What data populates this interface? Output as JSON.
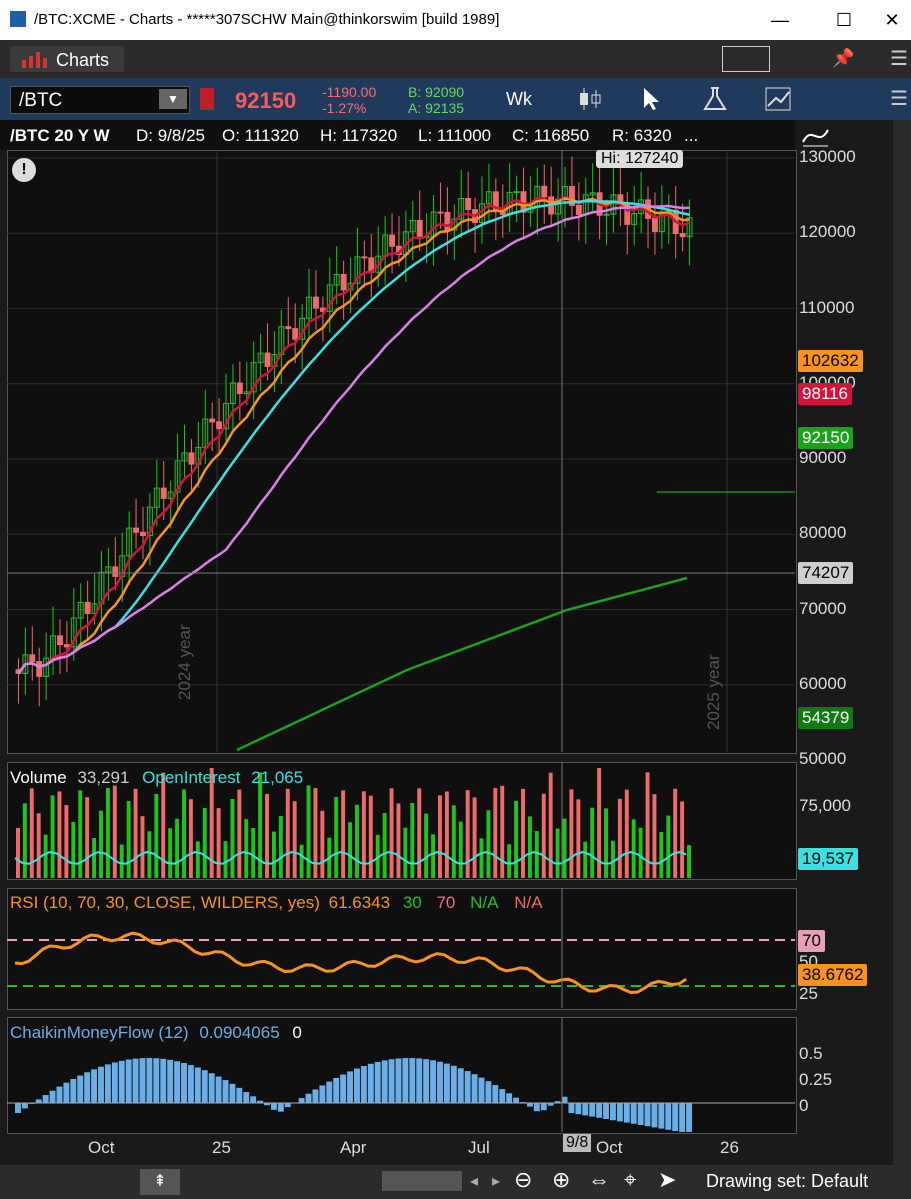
{
  "window": {
    "title": "/BTC:XCME - Charts - *****307SCHW Main@thinkorswim [build 1989]",
    "minimize": "—",
    "maximize": "☐",
    "close": "✕"
  },
  "tabs": {
    "charts": "Charts"
  },
  "toolbar": {
    "symbol": "/BTC",
    "last": "92150",
    "change": "-1190.00",
    "change_pct": "-1.27%",
    "bid": "B: 92090",
    "ask": "A: 92135",
    "period": "Wk"
  },
  "header": {
    "name": "/BTC 20 Y W",
    "date": "D: 9/8/25",
    "open": "O: 111320",
    "high": "H: 117320",
    "low": "L: 111000",
    "close": "C: 116850",
    "range": "R: 6320",
    "more": "..."
  },
  "price_chart": {
    "hi_label": "Hi: 127240",
    "y_ticks": [
      "130000",
      "120000",
      "110000",
      "100000",
      "90000",
      "80000",
      "70000",
      "60000",
      "50000"
    ],
    "tags": [
      {
        "text": "102632",
        "bg": "#f7931e",
        "fg": "#000"
      },
      {
        "text": "98116",
        "bg": "#d0143c",
        "fg": "#fff"
      },
      {
        "text": "92150",
        "bg": "#1aa31a",
        "fg": "#fff"
      },
      {
        "text": "74207",
        "bg": "#cfcfcf",
        "fg": "#000"
      },
      {
        "text": "54379",
        "bg": "#0f7a0f",
        "fg": "#fff"
      }
    ],
    "year_labels": [
      "2024 year",
      "2025 year"
    ],
    "colors": {
      "up": "#1ec41e",
      "down": "#f06a6a",
      "ma_red": "#d0143c",
      "ma_orange": "#f7931e",
      "ma_cyan": "#3de0e0",
      "ma_pink": "#d980e8",
      "ma_green": "#1aa31a"
    }
  },
  "volume": {
    "label": "Volume",
    "value": "33,291",
    "oi_label": "OpenInterest",
    "oi_value": "21,065",
    "tick": "75,000",
    "tag": "19,537"
  },
  "rsi": {
    "label": "RSI (10, 70, 30, CLOSE, WILDERS, yes)",
    "value": "61.6343",
    "v30": "30",
    "v70": "70",
    "na1": "N/A",
    "na2": "N/A",
    "tick70": "70",
    "tick50": "50",
    "tick25": "25",
    "tag": "38.6762"
  },
  "cmf": {
    "label": "ChaikinMoneyFlow (12)",
    "value": "0.0904065",
    "zero": "0",
    "ticks": [
      "0.5",
      "0.25",
      "0"
    ]
  },
  "x_axis": {
    "labels": [
      "Oct",
      "25",
      "Apr",
      "Jul",
      "Oct",
      "26"
    ],
    "cursor_date": "9/8"
  },
  "bottom": {
    "drawing_set": "Drawing set: Default"
  }
}
